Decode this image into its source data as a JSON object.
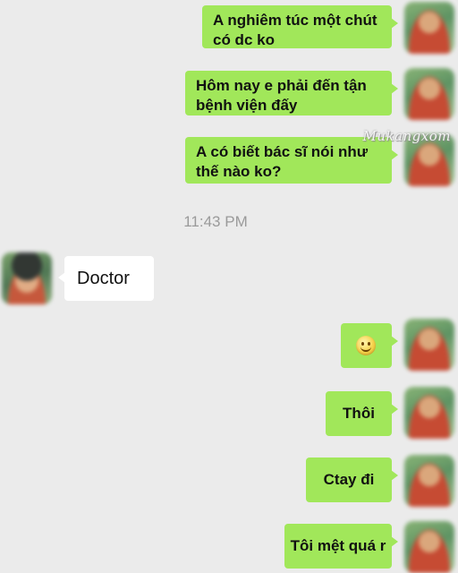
{
  "messages": [
    {
      "side": "sent",
      "text": "A nghiêm túc một chút có dc ko"
    },
    {
      "side": "sent",
      "text": "Hôm nay e phải đến tận bệnh viện đấy"
    },
    {
      "side": "sent",
      "text": "A có biết bác sĩ nói như thế nào ko?"
    },
    {
      "side": "received",
      "text": "Doctor"
    },
    {
      "side": "sent",
      "emoji": "smiley-emoji"
    },
    {
      "side": "sent",
      "text": "Thôi"
    },
    {
      "side": "sent",
      "text": "Ctay đi"
    },
    {
      "side": "sent",
      "text": "Tôi mệt quá r"
    }
  ],
  "timestamp": "11:43 PM",
  "watermark": "Mukangxom",
  "colors": {
    "sent_bubble": "#a1e75a",
    "received_bubble": "#ffffff",
    "background": "#ebebeb",
    "timestamp": "#9a9a9a"
  }
}
